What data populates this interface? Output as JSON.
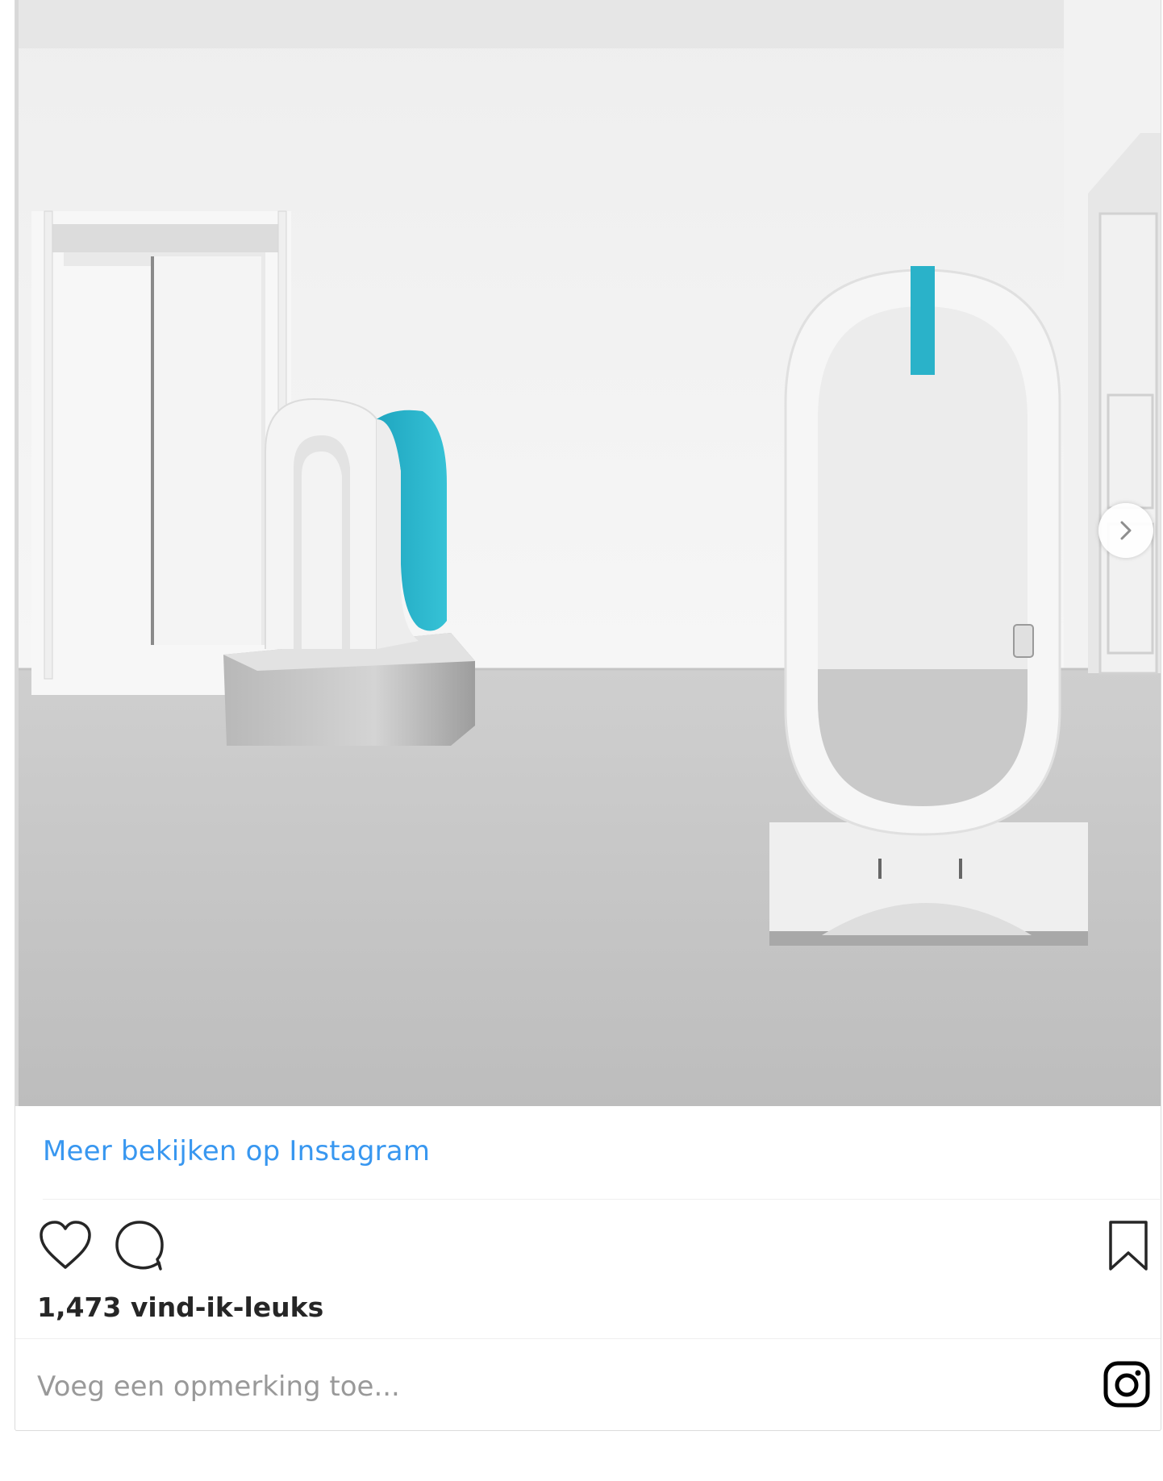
{
  "post": {
    "image_alt": "Gallery installation with two white and turquoise sculptures on a grey concrete floor",
    "next_icon": "chevron-right-icon"
  },
  "footer": {
    "view_more_label": "Meer bekijken op Instagram",
    "likes_text": "1,473 vind-ik-leuks",
    "comment_placeholder": "Voeg een opmerking toe...",
    "icons": {
      "like": "heart-icon",
      "comment": "comment-icon",
      "save": "bookmark-icon",
      "brand": "instagram-icon"
    }
  },
  "colors": {
    "link": "#3897f0",
    "text": "#262626",
    "placeholder": "#999999",
    "accent_turquoise": "#2ab2c9"
  }
}
